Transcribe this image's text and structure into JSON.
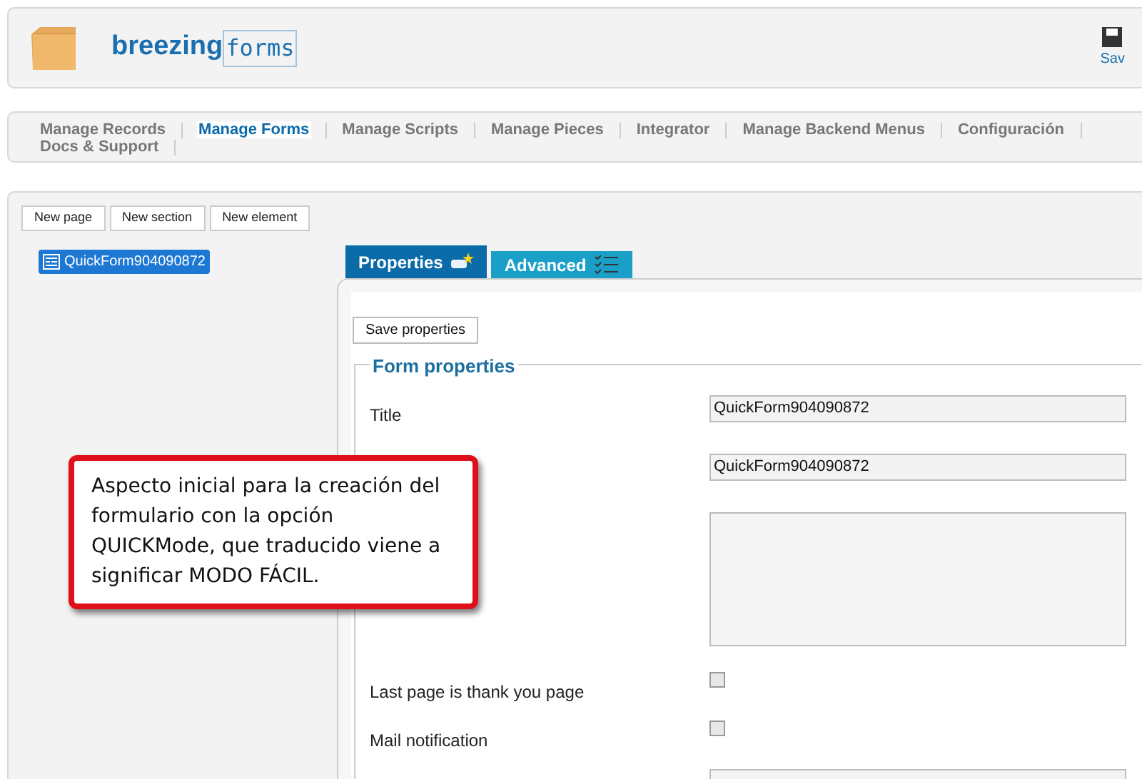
{
  "header": {
    "logo_bold": "breezing",
    "logo_light": "forms",
    "save_label": "Sav"
  },
  "nav": [
    {
      "label": "Manage Records",
      "selected": false
    },
    {
      "label": "Manage Forms",
      "selected": true
    },
    {
      "label": "Manage Scripts",
      "selected": false
    },
    {
      "label": "Manage Pieces",
      "selected": false
    },
    {
      "label": "Integrator",
      "selected": false
    },
    {
      "label": "Manage Backend Menus",
      "selected": false
    },
    {
      "label": "Configuración",
      "selected": false
    },
    {
      "label": "Docs & Support",
      "selected": false
    }
  ],
  "toolbar": [
    "New page",
    "New section",
    "New element"
  ],
  "tree": [
    {
      "label": "QuickForm904090872",
      "selected": true
    }
  ],
  "tabs": [
    {
      "label": "Properties",
      "selected": true,
      "kind": "properties"
    },
    {
      "label": "Advanced",
      "selected": false,
      "kind": "advanced"
    }
  ],
  "save_button": "Save properties",
  "fieldset_title": "Form properties",
  "fields": [
    {
      "kind": "text",
      "label": "Title",
      "value": "QuickForm904090872"
    },
    {
      "kind": "text",
      "value": "QuickForm904090872"
    },
    {
      "kind": "textarea"
    },
    {
      "kind": "checkbox",
      "label": "Last page is thank you page",
      "checked": false
    },
    {
      "kind": "checkbox",
      "label": "Mail notification",
      "checked": false
    },
    {
      "kind": "text"
    }
  ],
  "callout": "Aspecto inicial para la creación del formulario con la opción QUICKMode, que traducido viene a significar MODO FÁCIL."
}
